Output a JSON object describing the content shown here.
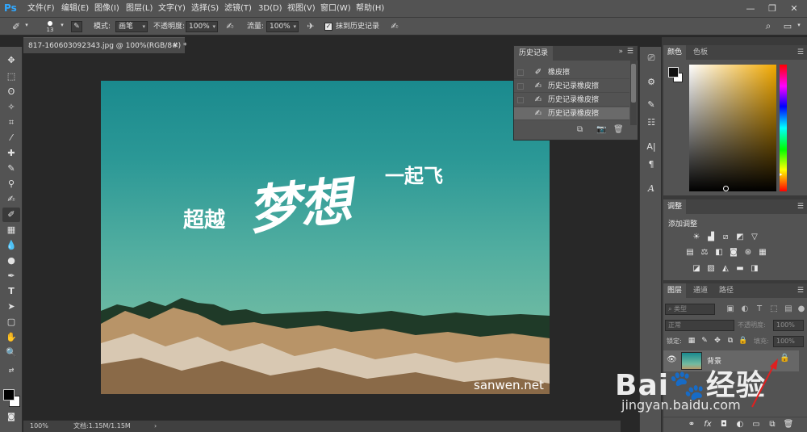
{
  "app": {
    "logo": "Ps"
  },
  "menu": [
    "文件(F)",
    "编辑(E)",
    "图像(I)",
    "图层(L)",
    "文字(Y)",
    "选择(S)",
    "滤镜(T)",
    "3D(D)",
    "视图(V)",
    "窗口(W)",
    "帮助(H)"
  ],
  "options": {
    "brush_size": "13",
    "mode_label": "模式:",
    "mode_value": "画笔",
    "opacity_label": "不透明度:",
    "opacity_value": "100%",
    "flow_label": "流量:",
    "flow_value": "100%",
    "erase_history_label": "抹到历史记录",
    "erase_history_checked": true
  },
  "document": {
    "tab_title": "817-160603092343.jpg @ 100%(RGB/8#) *",
    "zoom": "100%",
    "doc_info": "文档:1.15M/1.15M"
  },
  "photo": {
    "text_left": "超越",
    "text_main": "梦想",
    "text_right": "一起飞",
    "site": "sanwen.net"
  },
  "history": {
    "title": "历史记录",
    "items": [
      {
        "label": "橡皮擦",
        "icon": "eraser-icon"
      },
      {
        "label": "历史记录橡皮擦",
        "icon": "history-brush-icon"
      },
      {
        "label": "历史记录橡皮擦",
        "icon": "history-brush-icon"
      },
      {
        "label": "历史记录橡皮擦",
        "icon": "history-brush-icon",
        "selected": true
      }
    ]
  },
  "color_panel": {
    "tabs": [
      "颜色",
      "色板"
    ],
    "foreground": "#111111",
    "background": "#ffffff",
    "hue_color": "#f2a900"
  },
  "adjust_panel": {
    "title": "调整",
    "add_label": "添加调整"
  },
  "layers_panel": {
    "tabs": [
      "图层",
      "通道",
      "路径"
    ],
    "filter_kind": "类型",
    "blend_mode": "正常",
    "opacity_label": "不透明度:",
    "opacity_value": "100%",
    "lock_label": "锁定:",
    "fill_label": "填充:",
    "fill_value": "100%",
    "layer_name": "背景"
  },
  "watermark": {
    "brand": "Bai",
    "brand_suffix": "经验",
    "url": "jingyan.baidu.com"
  }
}
